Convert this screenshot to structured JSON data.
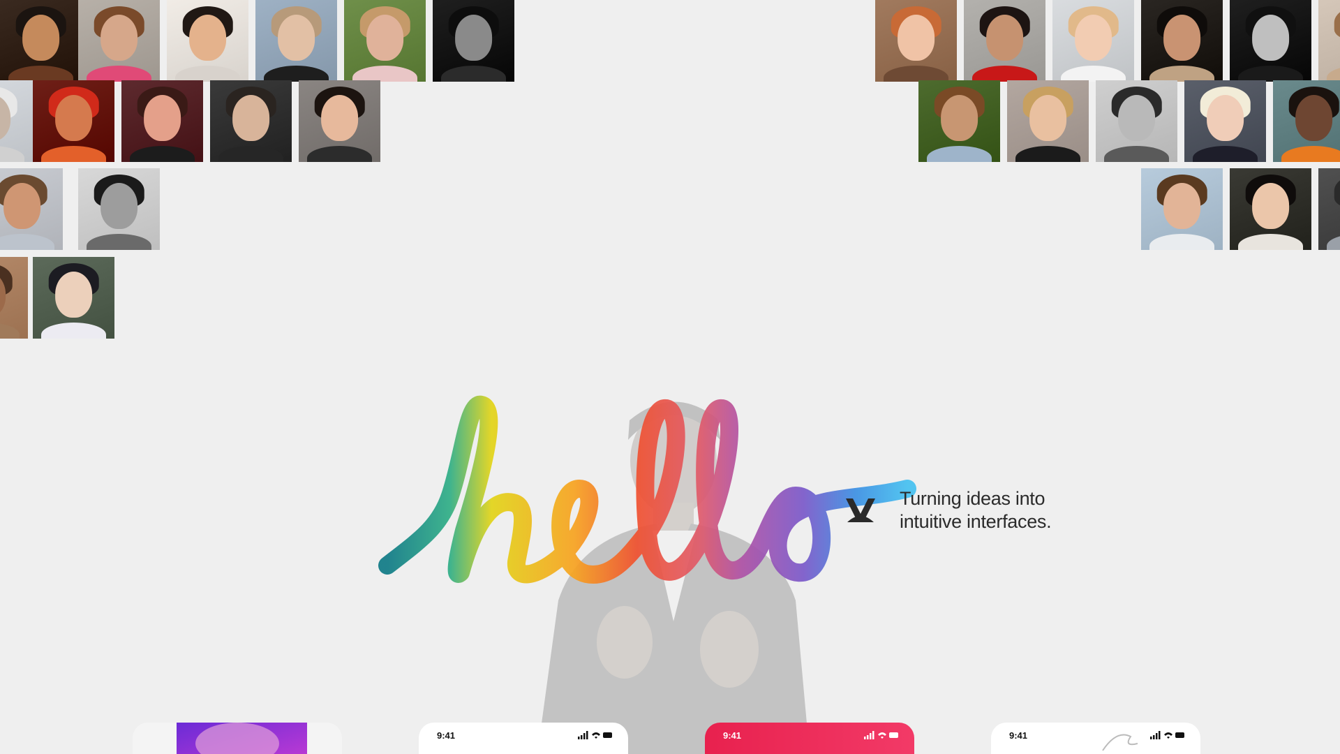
{
  "tagline": {
    "line1": "Turning ideas into",
    "line2": "intuitive interfaces."
  },
  "hero_word": "hello",
  "phones": [
    {
      "time": ""
    },
    {
      "time": "9:41"
    },
    {
      "time": "9:41"
    },
    {
      "time": "9:41"
    }
  ],
  "colors": {
    "background": "#efefef",
    "text": "#2b2b2b",
    "phone_accent": "#e8214e",
    "hello_gradient": [
      "#0f7a86",
      "#2fae86",
      "#e2d417",
      "#f7a21f",
      "#f0502f",
      "#b052a6",
      "#7a58c9",
      "#3b8fe3",
      "#45c0f0"
    ]
  },
  "icons": [
    "signal-icon",
    "wifi-icon",
    "battery-icon",
    "brand-logo-icon"
  ]
}
